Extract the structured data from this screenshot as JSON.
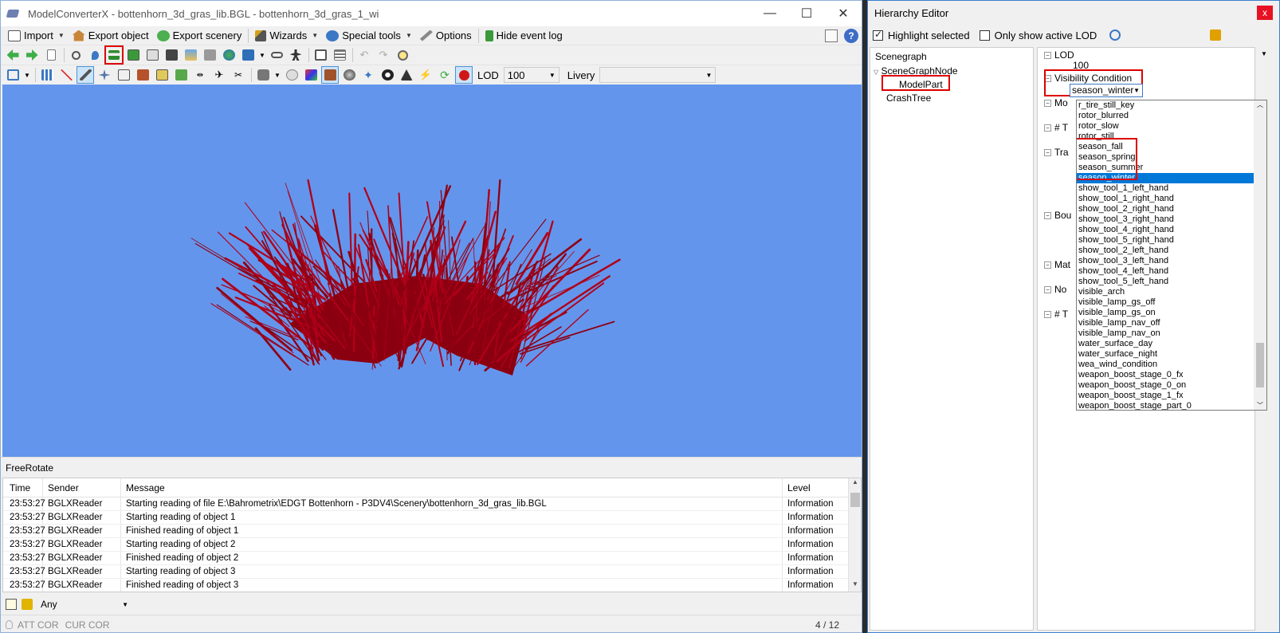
{
  "main_window": {
    "title": "ModelConverterX - bottenhorn_3d_gras_lib.BGL - bottenhorn_3d_gras_1_wi",
    "controls": {
      "minimize": "—",
      "maximize": "☐",
      "close": "✕"
    }
  },
  "menu": {
    "import": "Import",
    "export_object": "Export object",
    "export_scenery": "Export scenery",
    "wizards": "Wizards",
    "special_tools": "Special tools",
    "options": "Options",
    "hide_event_log": "Hide event log",
    "help_icon": "?"
  },
  "toolbar3": {
    "lod_label": "LOD",
    "lod_value": "100",
    "livery_label": "Livery",
    "livery_value": ""
  },
  "viewport": {
    "background": "#6495ed",
    "model_color": "#b00018"
  },
  "status_top": "FreeRotate",
  "log": {
    "columns": [
      "Time",
      "Sender",
      "Message",
      "Level"
    ],
    "rows": [
      {
        "time": "23:53:27",
        "sender": "BGLXReader",
        "message": "Starting reading of file E:\\Bahrometrix\\EDGT Bottenhorn - P3DV4\\Scenery\\bottenhorn_3d_gras_lib.BGL",
        "level": "Information"
      },
      {
        "time": "23:53:27",
        "sender": "BGLXReader",
        "message": "Starting reading of object 1",
        "level": "Information"
      },
      {
        "time": "23:53:27",
        "sender": "BGLXReader",
        "message": "Finished reading of object 1",
        "level": "Information"
      },
      {
        "time": "23:53:27",
        "sender": "BGLXReader",
        "message": "Starting reading of object 2",
        "level": "Information"
      },
      {
        "time": "23:53:27",
        "sender": "BGLXReader",
        "message": "Finished reading of object 2",
        "level": "Information"
      },
      {
        "time": "23:53:27",
        "sender": "BGLXReader",
        "message": "Starting reading of object 3",
        "level": "Information"
      },
      {
        "time": "23:53:27",
        "sender": "BGLXReader",
        "message": "Finished reading of object 3",
        "level": "Information"
      }
    ]
  },
  "filter": {
    "value": "Any"
  },
  "bottom_status": {
    "att": "ATT COR",
    "cur": "CUR COR",
    "page": "4 / 12"
  },
  "hierarchy_editor": {
    "title": "Hierarchy Editor",
    "close": "x",
    "highlight_selected": "Highlight selected",
    "only_active_lod": "Only show active LOD",
    "scenegraph": {
      "header": "Scenegraph",
      "node": "SceneGraphNode",
      "child": "ModelPart",
      "crash": "CrashTree"
    },
    "props": {
      "lod_header": "LOD",
      "lod_value": "100",
      "visibility_header": "Visibility Condition",
      "visibility_value": "season_winter",
      "partial": [
        "Mo",
        "# T",
        "Tra",
        "Bou",
        "Mat",
        "No",
        "# T"
      ]
    },
    "dropdown_items": [
      "r_tire_still_key",
      "rotor_blurred",
      "rotor_slow",
      "rotor_still",
      "season_fall",
      "season_spring",
      "season_summer",
      "season_winter",
      "show_tool_1_left_hand",
      "show_tool_1_right_hand",
      "show_tool_2_right_hand",
      "show_tool_3_right_hand",
      "show_tool_4_right_hand",
      "show_tool_5_right_hand",
      "show_tool_2_left_hand",
      "show_tool_3_left_hand",
      "show_tool_4_left_hand",
      "show_tool_5_left_hand",
      "visible_arch",
      "visible_lamp_gs_off",
      "visible_lamp_gs_on",
      "visible_lamp_nav_off",
      "visible_lamp_nav_on",
      "water_surface_day",
      "water_surface_night",
      "wea_wind_condition",
      "weapon_boost_stage_0_fx",
      "weapon_boost_stage_0_on",
      "weapon_boost_stage_1_fx",
      "weapon_boost_stage_part_0"
    ],
    "selected_index": 7
  }
}
